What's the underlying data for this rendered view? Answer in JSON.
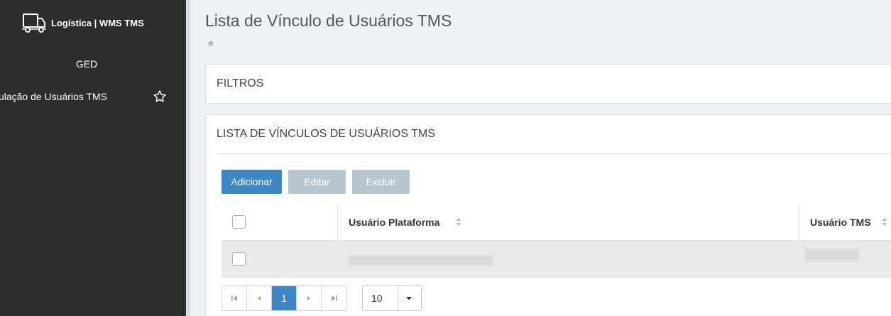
{
  "sidebar": {
    "brand": "Logística | WMS TMS",
    "logo_icon": "truck-icon",
    "items": [
      {
        "label": "GED"
      },
      {
        "label": "Vinculação de Usuários TMS",
        "icon": "star-outline-icon"
      }
    ]
  },
  "page": {
    "title": "Lista de Vínculo de Usuários TMS",
    "breadcrumb_icon": "home-icon"
  },
  "filters_panel": {
    "title": "FILTROS"
  },
  "list_panel": {
    "title": "LISTA DE VÍNCULOS DE USUÁRIOS TMS",
    "buttons": {
      "add": "Adicionar",
      "edit": "Editar",
      "delete": "Excluir"
    },
    "columns": [
      "Usuário Plataforma",
      "Usuário TMS"
    ],
    "rows": [
      {
        "usuario_plataforma": "",
        "usuario_tms": ""
      }
    ],
    "pagination": {
      "current_page": "1",
      "page_size": "10"
    }
  },
  "colors": {
    "sidebar_bg": "#2d2d2d",
    "primary": "#3d87c7",
    "disabled_button": "#b8c4ce",
    "row_highlight": "#eaeaea"
  }
}
